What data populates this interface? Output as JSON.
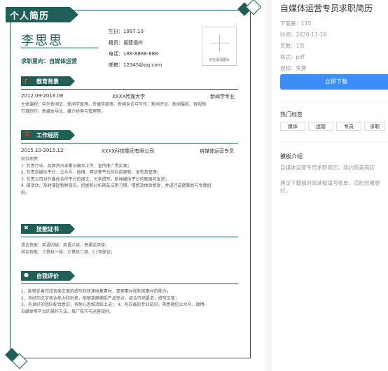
{
  "resume": {
    "header": "个人简历",
    "name": "李思思",
    "intent": "求职意向：自媒体运营",
    "birthday": "生日：1997.10",
    "hometown": "籍贯：福建福州",
    "phone": "电话：188-8888-888",
    "email": "邮箱：12345@qq.com",
    "photo_caption": "点击添加图片",
    "education": {
      "title": "教育背景",
      "period": "2012.09-2016.06",
      "school": "XXXX传媒大学",
      "major": "新闻学专业",
      "courses": [
        "主修课程：中外新闻史、新闻学原理、传播学原理、新闻采访与写作、新闻评论、新闻摄影、音视频",
        "节目制作、新媒体导论、媒介经营与管理等。"
      ]
    },
    "work": {
      "title": "工作经历",
      "period": "2015.10-2015.12",
      "company": "XXXX科技集团有限公司",
      "position": "自媒体运营专员",
      "duties": [
        "岗位职责：",
        "1. 负责行业、品牌资讯采集与编写上传，宣传推广贯实案；",
        "2. 负责自媒体平台：公众号、微博、网站等平台的栏目更新、发布及管理；",
        "3. 负责公司对外媒体合作平台的搜文、头条撰写，新闻媒体平台的联络与发送；",
        "4. 做活动、及时捕捉新鲜资讯，挖掘和分析网友试用习惯、情感及体验感受，并进行选题策划与专题组",
        "织。"
      ]
    },
    "skills": {
      "title": "技能证书",
      "lines": [
        "语言技能：英语四级、英语六级、普通话甲级；",
        "其余技能：计算机一级、计算机二级、C1驾驶证；"
      ]
    },
    "evaluation": {
      "title": "自我评价",
      "lines": [
        "1．能够妥善完成各类文案的撰写和快速收集素材，整理素材和利用素材的能力；",
        "2．良好的文字表达能力和创意，能够准确捕捉产品亮点，结合市场要求，撰写文案；",
        "3．有良好的团队配合意识，有耐心思维活跃上进；  4、有较高的专业知识，熟悉微信公众号、微博、",
        "自媒体等平台的操作方法、推广技巧与运营规则。"
      ]
    }
  },
  "details": {
    "title": "自媒体运营专员求职简历",
    "downloads": "下载量：115",
    "time": "时间：2020-11-16",
    "pages": "页数：1页",
    "format": "格式：pdf",
    "license": "授权：免费",
    "download_button": "立即下载",
    "tags_heading": "热门标签",
    "tags": [
      "媒体",
      "运营",
      "专员",
      "求职"
    ],
    "intro_heading": "模板介绍",
    "intro_line1": "自媒体运营专员求职简历，简约简美简历",
    "intro_line2": "建议下载稿时阅读稿填写表单，适配效果更",
    "intro_line3": "好。"
  },
  "colors": {
    "accent": "#1f5f57",
    "button": "#3a8ef6"
  }
}
